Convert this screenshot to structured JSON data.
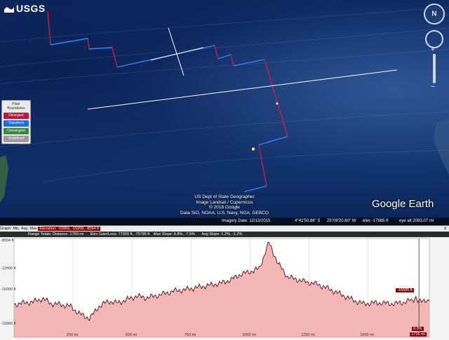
{
  "brand": {
    "logo_text": "USGS"
  },
  "legend": {
    "title_line1": "Plate",
    "title_line2": "Boundaries",
    "items": [
      {
        "label": "Divergent",
        "color": "#c0143c"
      },
      {
        "label": "Transform",
        "color": "#1f6fe0"
      },
      {
        "label": "Convergent",
        "color": "#3a8a3a"
      },
      {
        "label": "Undefined",
        "color": "#9a9a9a"
      }
    ]
  },
  "navigation": {
    "north_label": "N"
  },
  "credits": {
    "line1": "US Dept of State Geographer",
    "line2": "Image Landsat / Copernicus",
    "line3": "© 2018 Google",
    "line4": "Data SIO, NOAA, U.S. Navy, NGA, GEBCO"
  },
  "app_logo": "Google Earth",
  "status_bar": {
    "imagery_date": "Imagery Date: 12/13/2015",
    "latitude": "4°41'50.88\" S",
    "longitude": "25°09'20.60\" W",
    "elevation": "elev -17665 ft",
    "eye_alt": "eye alt 2093.07 mi"
  },
  "profile": {
    "graph_label": "Graph: Min, Avg, Max",
    "elevation_stats": "Elevation: -19966, -15208, -8554 ft",
    "range_totals": "Range Totals: Distance: 1760 mi",
    "elev_gain_loss": "Elev Gain/Loss: 77303 ft, -75796 ft",
    "max_slope": "Max Slope: 8.8%, -7.5%",
    "avg_slope": "Avg Slope: 1.2%, -1.2%",
    "close_label": "×",
    "y_ticks": [
      "-8554 ft",
      "-12500 ft",
      "-15000 ft",
      "-19966 ft"
    ],
    "x_ticks": [
      "250 mi",
      "500 mi",
      "750 mi",
      "1000 mi",
      "1250 mi",
      "1500 mi"
    ],
    "selected_x": "1716 mi",
    "cursor_value": "-15585 ft",
    "cursor_slope": "0.3%",
    "fill_color": "#f3b7b7",
    "line_color": "#5a0b0b"
  },
  "chart_data": {
    "type": "area",
    "x": [
      0,
      40,
      80,
      120,
      160,
      200,
      240,
      280,
      320,
      360,
      400,
      440,
      480,
      520,
      560,
      600,
      640,
      680,
      720,
      760,
      800,
      840,
      880,
      920,
      960,
      1000,
      1040,
      1080,
      1120,
      1160,
      1200,
      1240,
      1280,
      1320,
      1360,
      1400,
      1440,
      1480,
      1520,
      1560,
      1600,
      1640,
      1680,
      1716,
      1760
    ],
    "y": [
      -16200,
      -16000,
      -15900,
      -15500,
      -16100,
      -16200,
      -16400,
      -17300,
      -17800,
      -16400,
      -15800,
      -16000,
      -15600,
      -15200,
      -15400,
      -15200,
      -14900,
      -14600,
      -14500,
      -14300,
      -14100,
      -13900,
      -13700,
      -13300,
      -12700,
      -12400,
      -12000,
      -9000,
      -11500,
      -13000,
      -13300,
      -13600,
      -13800,
      -14200,
      -14700,
      -15200,
      -15700,
      -16100,
      -16000,
      -16000,
      -16100,
      -16000,
      -15700,
      -15585,
      -15800
    ],
    "ylim": [
      -19966,
      -8554
    ],
    "xlim": [
      0,
      1760
    ]
  }
}
